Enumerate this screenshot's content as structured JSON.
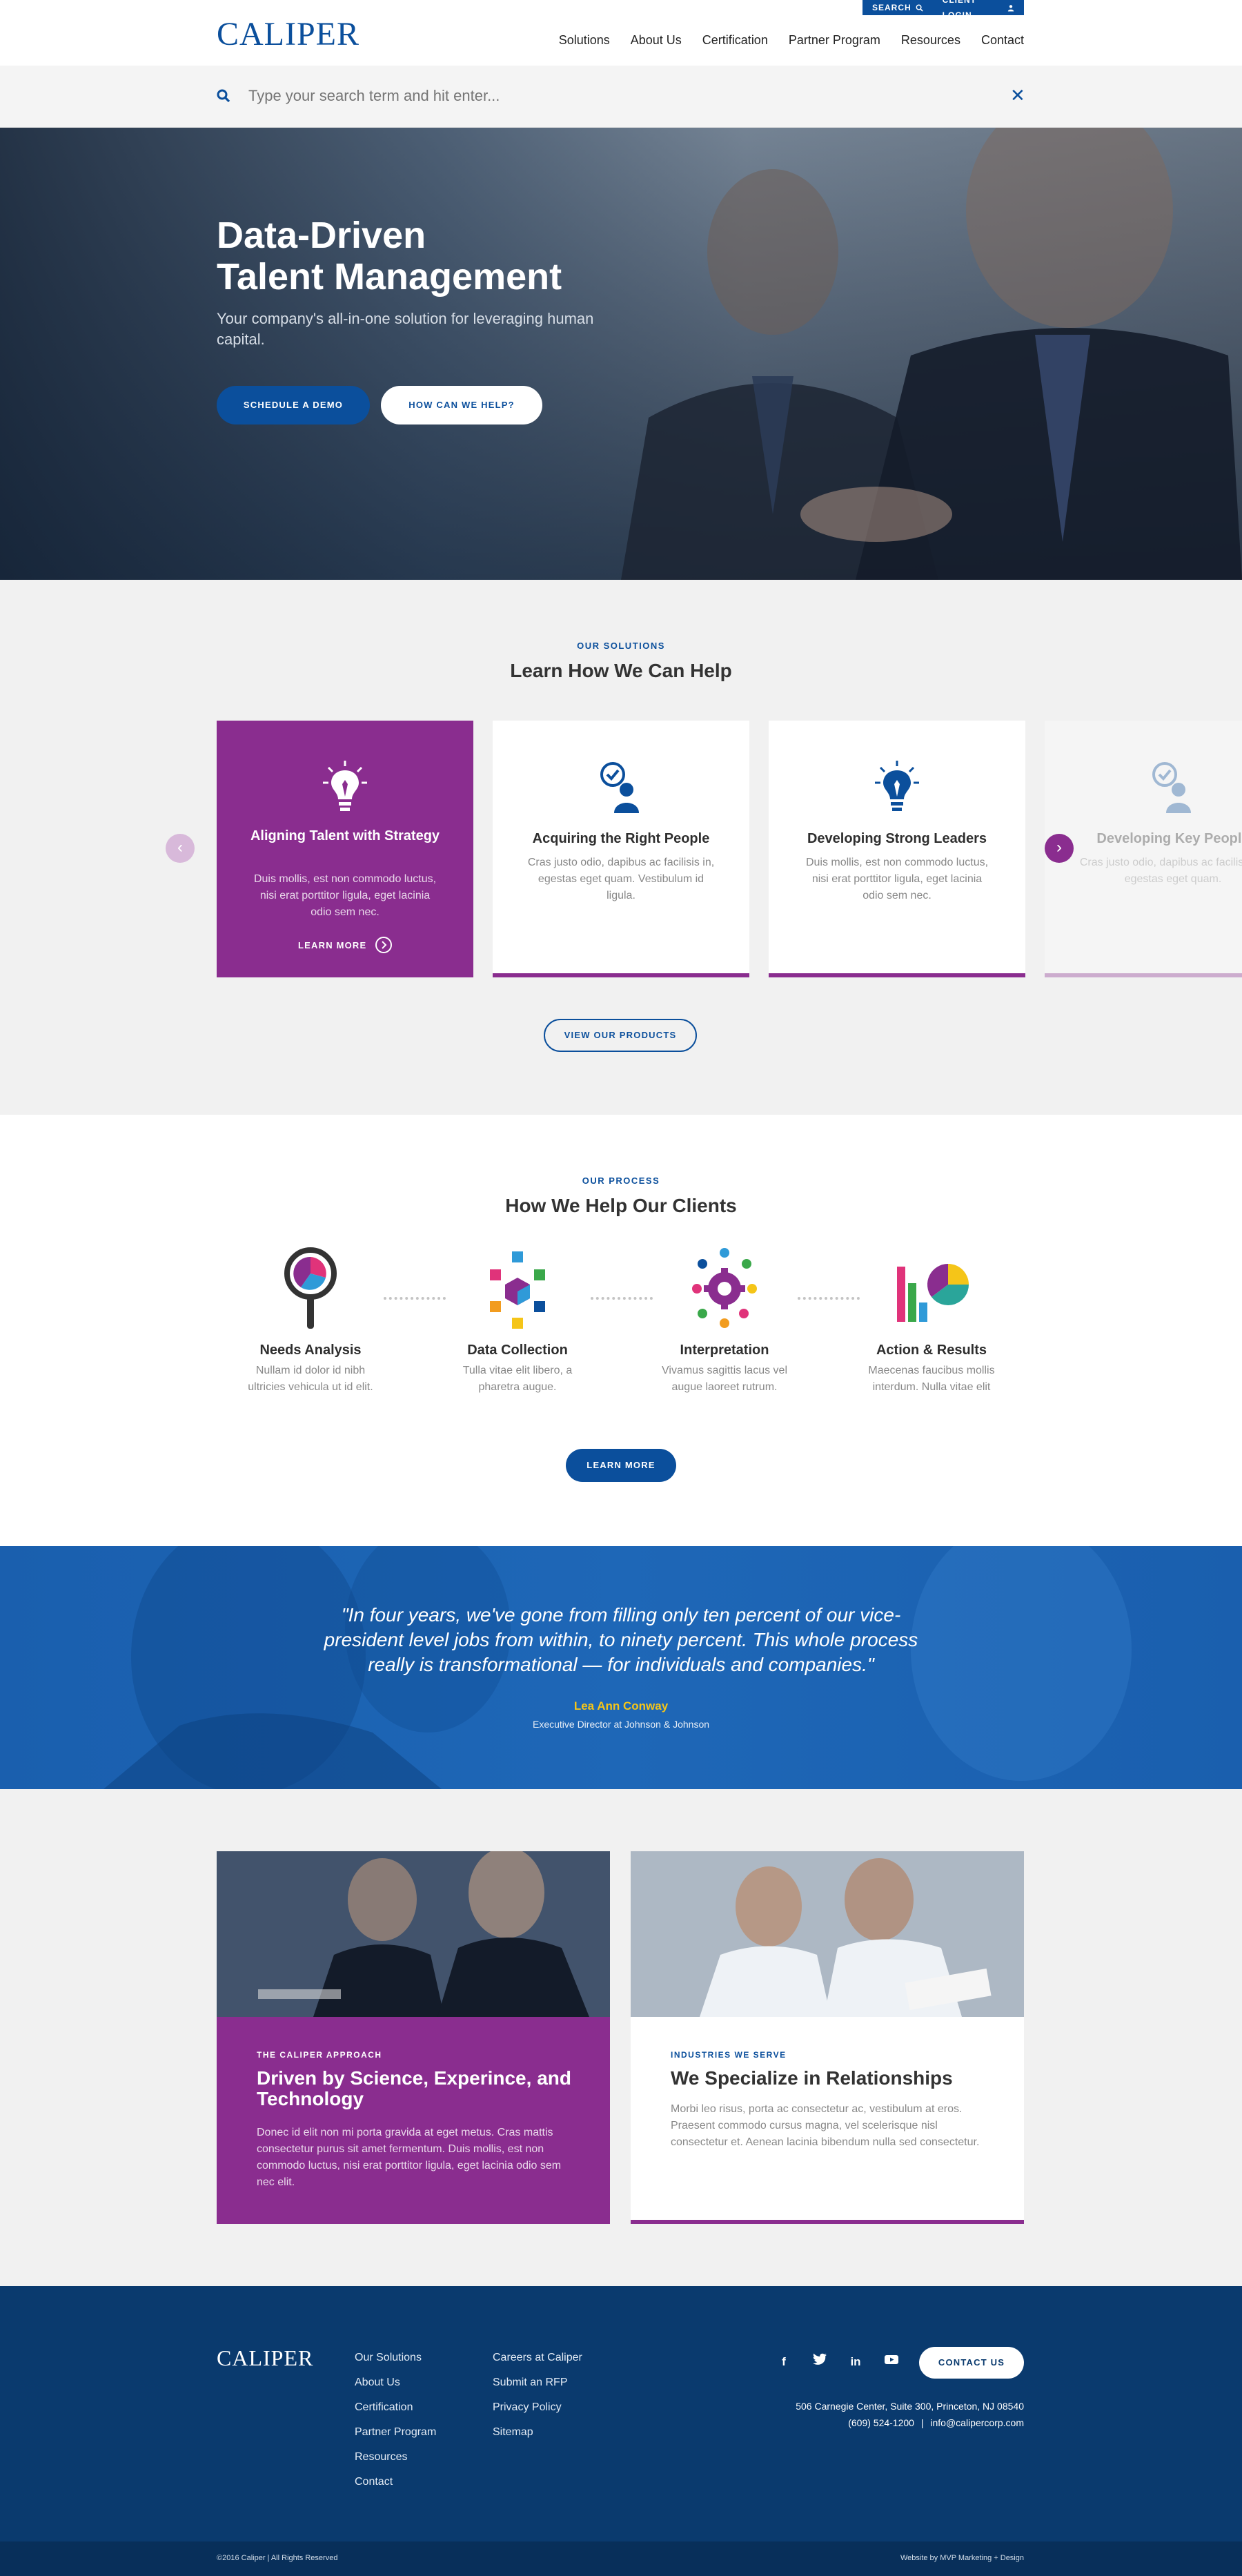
{
  "brand": {
    "logo_text": "CALIPER",
    "primary_color": "#0b4f9c",
    "accent_color": "#8a2d8f",
    "footer_color": "#0a3a6e",
    "highlight_color": "#f5c518"
  },
  "utility": {
    "search_label": "SEARCH",
    "login_label": "CLIENT LOGIN"
  },
  "nav": [
    "Solutions",
    "About Us",
    "Certification",
    "Partner Program",
    "Resources",
    "Contact"
  ],
  "search": {
    "placeholder": "Type your search term and hit enter...",
    "close_icon": "close-icon"
  },
  "hero": {
    "title_line1": "Data-Driven",
    "title_line2": "Talent Management",
    "subtitle": "Your company's all-in-one solution for leveraging human capital.",
    "primary_button": "SCHEDULE A DEMO",
    "secondary_button": "HOW CAN WE HELP?"
  },
  "solutions": {
    "eyebrow": "OUR SOLUTIONS",
    "title": "Learn How We Can Help",
    "cards": [
      {
        "title": "Aligning Talent with Strategy",
        "desc": "Duis mollis, est non commodo luctus, nisi erat porttitor ligula, eget lacinia odio sem nec.",
        "link": "LEARN MORE",
        "icon": "lightbulb-icon"
      },
      {
        "title": "Acquiring the Right People",
        "desc": "Cras justo odio, dapibus ac facilisis in, egestas eget quam. Vestibulum id ligula.",
        "icon": "person-check-icon"
      },
      {
        "title": "Developing Strong Leaders",
        "desc": "Duis mollis, est non commodo luctus, nisi erat porttitor ligula, eget lacinia odio sem nec.",
        "icon": "lightbulb-icon"
      },
      {
        "title": "Developing Key People",
        "desc": "Cras justo odio, dapibus ac facilisis in, egestas eget quam.",
        "icon": "person-check-icon"
      }
    ],
    "button": "VIEW OUR PRODUCTS"
  },
  "process": {
    "eyebrow": "OUR PROCESS",
    "title": "How We Help Our Clients",
    "steps": [
      {
        "title": "Needs Analysis",
        "desc": "Nullam id dolor id nibh ultricies vehicula ut id elit.",
        "icon": "magnifier-chart-icon"
      },
      {
        "title": "Data Collection",
        "desc": "Tulla vitae elit libero, a pharetra augue.",
        "icon": "data-cubes-icon"
      },
      {
        "title": "Interpretation",
        "desc": "Vivamus sagittis lacus vel augue laoreet rutrum.",
        "icon": "gear-dots-icon"
      },
      {
        "title": "Action & Results",
        "desc": "Maecenas faucibus mollis interdum. Nulla vitae elit",
        "icon": "bar-pie-chart-icon"
      }
    ],
    "button": "LEARN MORE"
  },
  "testimonial": {
    "quote": "\"In four years, we've gone from filling only ten percent of our vice-president level jobs from within, to ninety percent. This whole process really is transformational — for individuals and companies.\"",
    "name": "Lea Ann Conway",
    "role": "Executive Director at Johnson & Johnson"
  },
  "features": [
    {
      "eyebrow": "THE CALIPER APPROACH",
      "title": "Driven by Science, Experince, and Technology",
      "desc": "Donec id elit non mi porta gravida at eget metus. Cras mattis consectetur purus sit amet fermentum. Duis mollis, est non commodo luctus, nisi erat porttitor ligula, eget lacinia odio sem nec elit."
    },
    {
      "eyebrow": "INDUSTRIES WE SERVE",
      "title": "We Specialize in Relationships",
      "desc": "Morbi leo risus, porta ac consectetur ac, vestibulum at eros. Praesent commodo cursus magna, vel scelerisque nisl consectetur et. Aenean lacinia bibendum nulla sed consectetur."
    }
  ],
  "footer": {
    "logo_text": "CALIPER",
    "col1": [
      "Our Solutions",
      "About Us",
      "Certification",
      "Partner Program",
      "Resources",
      "Contact"
    ],
    "col2": [
      "Careers at Caliper",
      "Submit an RFP",
      "Privacy  Policy",
      "Sitemap"
    ],
    "social": [
      "f",
      "twitter-icon",
      "in",
      "youtube-icon"
    ],
    "contact_button": "CONTACT US",
    "address": "506 Carnegie Center, Suite 300, Princeton, NJ 08540",
    "phone": "(609) 524-1200",
    "email": "info@calipercorp.com",
    "separator": "|",
    "copyright": "©2016 Caliper | All Rights Reserved",
    "credit": "Website by MVP Marketing + Design"
  }
}
